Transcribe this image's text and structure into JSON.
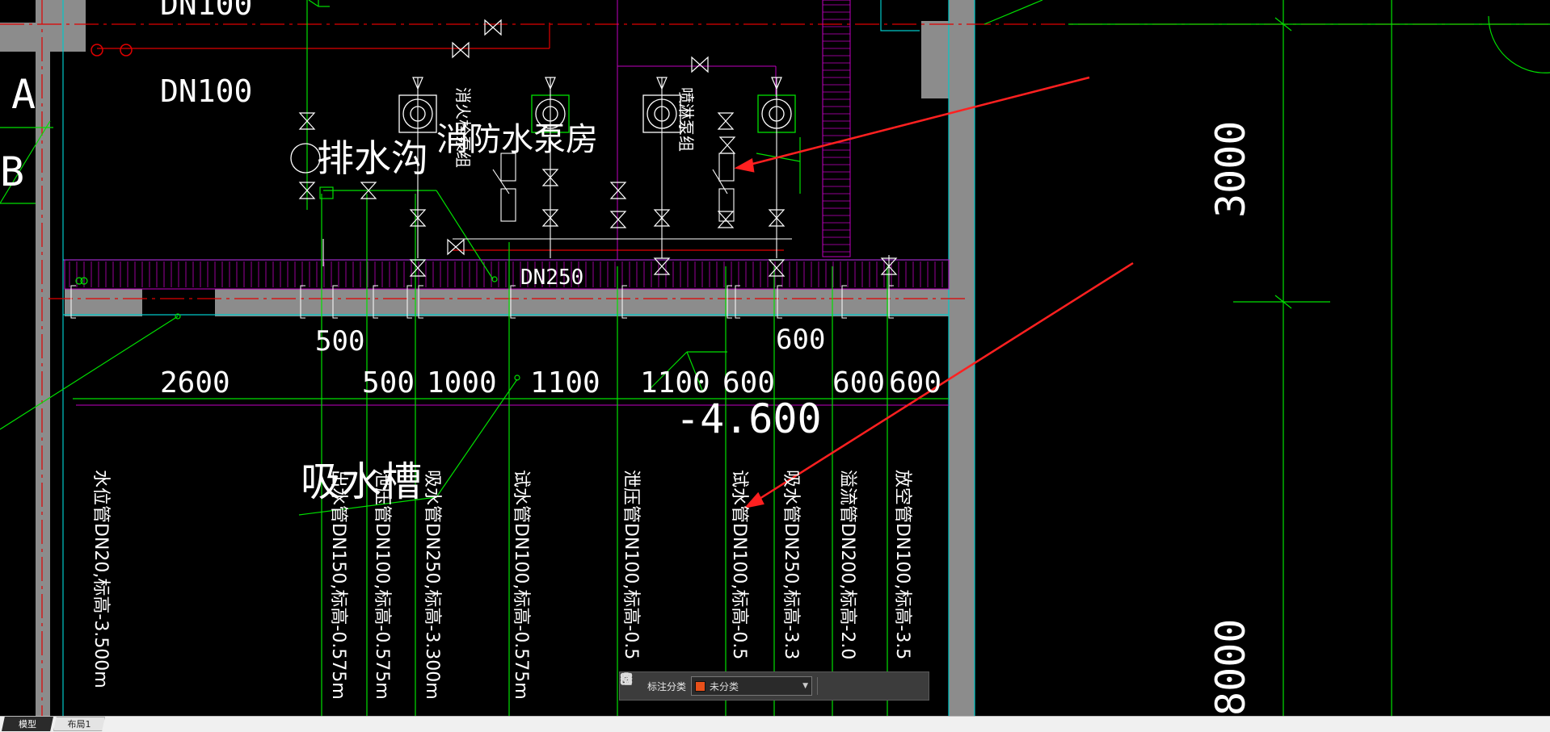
{
  "drawing": {
    "grid_labels": [
      "A",
      "B"
    ],
    "pipe_labels": {
      "dn100_top": "DN100",
      "dn100": "DN100",
      "dn250": "DN250"
    },
    "room_labels": {
      "drainage_ditch": "排水沟",
      "fire_pump_room": "消防水泵房",
      "hydrant_pump_group": "消火栓泵组",
      "sprinkler_pump_group": "喷淋泵组",
      "suction_tank": "吸水槽"
    },
    "dimensions": {
      "top_500": "500",
      "top_600": "600",
      "row": [
        "2600",
        "500",
        "1000",
        "1100",
        "1100",
        "600",
        "600",
        "600"
      ],
      "elevation": "-4.600",
      "right_3000": "3000",
      "right_8000": "8000"
    },
    "vertical_labels": [
      "水位管DN20,标高-3.500m",
      "出水管DN150,标高-0.575m",
      "泄压管DN100,标高-0.575m",
      "吸水管DN250,标高-3.300m",
      "试水管DN100,标高-0.575m",
      "泄压管DN100,标高-0.5",
      "试水管DN100,标高-0.5",
      "吸水管DN250,标高-3.3",
      "溢流管DN200,标高-2.0",
      "放空管DN100,标高-3.5"
    ]
  },
  "toolbar": {
    "label": "标注分类",
    "category_value": "未分类",
    "category_color": "#e8501a"
  },
  "tabs": [
    {
      "label": "模型",
      "active": true
    },
    {
      "label": "布局1",
      "active": false
    }
  ],
  "colors": {
    "wall": "#8c8c8c",
    "pipe_green": "#00e000",
    "axis_red": "#e00000",
    "magenta": "#c000c0",
    "white": "#ffffff",
    "cyan": "#00c8c8",
    "arrow_red": "#ff2020"
  }
}
